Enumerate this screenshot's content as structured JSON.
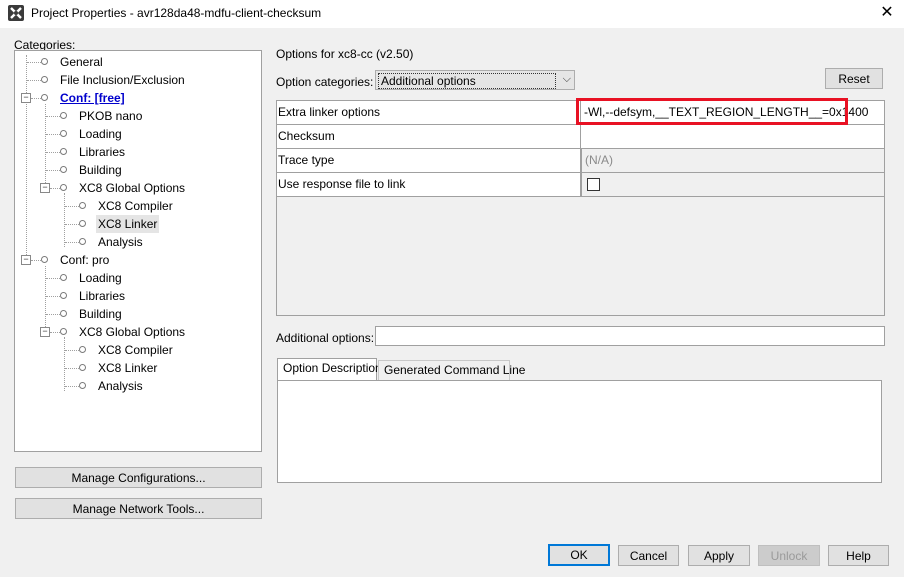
{
  "window": {
    "title": "Project Properties - avr128da48-mdfu-client-checksum",
    "close_glyph": "✕"
  },
  "categories": {
    "label": "Categories:",
    "tree": [
      {
        "label": "General"
      },
      {
        "label": "File Inclusion/Exclusion"
      },
      {
        "label": "Conf: [free]"
      },
      {
        "label": "PKOB nano"
      },
      {
        "label": "Loading"
      },
      {
        "label": "Libraries"
      },
      {
        "label": "Building"
      },
      {
        "label": "XC8 Global Options"
      },
      {
        "label": "XC8 Compiler"
      },
      {
        "label": "XC8 Linker"
      },
      {
        "label": "Analysis"
      },
      {
        "label": "Conf: pro"
      },
      {
        "label": "Loading"
      },
      {
        "label": "Libraries"
      },
      {
        "label": "Building"
      },
      {
        "label": "XC8 Global Options"
      },
      {
        "label": "XC8 Compiler"
      },
      {
        "label": "XC8 Linker"
      },
      {
        "label": "Analysis"
      }
    ],
    "expander_glyph": "−"
  },
  "buttons": {
    "manage_configurations": "Manage Configurations...",
    "manage_network_tools": "Manage Network Tools...",
    "reset": "Reset",
    "ok": "OK",
    "cancel": "Cancel",
    "apply": "Apply",
    "unlock": "Unlock",
    "help": "Help"
  },
  "options": {
    "header": "Options for xc8-cc (v2.50)",
    "category_label": "Option categories:",
    "category_value": "Additional options",
    "chevron": "⌵",
    "rows": [
      {
        "name": "Extra linker options",
        "value": "-Wl,--defsym,__TEXT_REGION_LENGTH__=0x1400"
      },
      {
        "name": "Checksum",
        "value": ""
      },
      {
        "name": "Trace type",
        "value": "(N/A)"
      },
      {
        "name": "Use response file to link",
        "value": ""
      }
    ],
    "additional_label": "Additional options:",
    "additional_value": ""
  },
  "tabs": {
    "description": "Option Description",
    "command_line": "Generated Command Line"
  },
  "colors": {
    "highlight": "#e81123",
    "link": "#0000cc",
    "default_button_border": "#0078d7"
  }
}
